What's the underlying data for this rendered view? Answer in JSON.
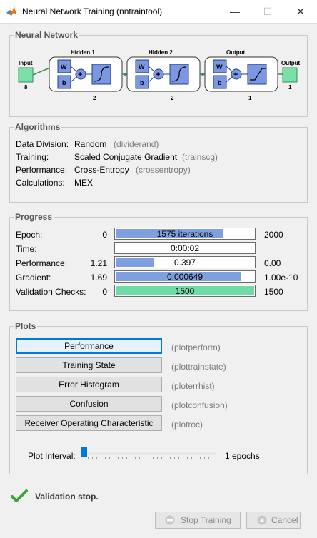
{
  "window": {
    "title": "Neural Network Training (nntraintool)",
    "controls": {
      "minimize": "—",
      "maximize": "☐",
      "close": "✕"
    }
  },
  "network": {
    "panel_title": "Neural Network",
    "input_label": "Input",
    "input_size": "8",
    "layers": [
      {
        "title": "Hidden 1",
        "size": "2"
      },
      {
        "title": "Hidden 2",
        "size": "2"
      },
      {
        "title": "Output",
        "size": "1"
      }
    ],
    "output_label": "Output",
    "output_size": "1",
    "w_label": "W",
    "b_label": "b",
    "plus_label": "+"
  },
  "algorithms": {
    "panel_title": "Algorithms",
    "rows": [
      {
        "label": "Data Division:",
        "value": "Random",
        "fn": "(dividerand)"
      },
      {
        "label": "Training:",
        "value": "Scaled Conjugate Gradient",
        "fn": "(trainscg)"
      },
      {
        "label": "Performance:",
        "value": "Cross-Entropy",
        "fn": "(crossentropy)"
      },
      {
        "label": "Calculations:",
        "value": "MEX",
        "fn": ""
      }
    ]
  },
  "progress": {
    "panel_title": "Progress",
    "rows": [
      {
        "label": "Epoch:",
        "start": "0",
        "value": "1575 iterations",
        "end": "2000",
        "fill": 0.775,
        "color": "#7e9fe0"
      },
      {
        "label": "Time:",
        "start": "",
        "value": "0:00:02",
        "end": "",
        "fill": 0,
        "color": "#7e9fe0"
      },
      {
        "label": "Performance:",
        "start": "1.21",
        "value": "0.397",
        "end": "0.00",
        "fill": 0.28,
        "color": "#7e9fe0"
      },
      {
        "label": "Gradient:",
        "start": "1.69",
        "value": "0.000649",
        "end": "1.00e-10",
        "fill": 0.905,
        "color": "#7e9fe0"
      },
      {
        "label": "Validation Checks:",
        "start": "0",
        "value": "1500",
        "end": "1500",
        "fill": 1.0,
        "color": "#6fdca6"
      }
    ]
  },
  "plots": {
    "panel_title": "Plots",
    "buttons": [
      {
        "label": "Performance",
        "fn": "(plotperform)"
      },
      {
        "label": "Training State",
        "fn": "(plottrainstate)"
      },
      {
        "label": "Error Histogram",
        "fn": "(ploterrhist)"
      },
      {
        "label": "Confusion",
        "fn": "(plotconfusion)"
      },
      {
        "label": "Receiver Operating Characteristic",
        "fn": "(plotroc)"
      }
    ],
    "interval_label": "Plot Interval:",
    "interval_value": "1 epochs",
    "slider_fraction": 0.0
  },
  "status": {
    "text": "Validation stop.",
    "icon": "checkmark-icon"
  },
  "footer": {
    "stop_label": "Stop Training",
    "cancel_label": "Cancel"
  },
  "colors": {
    "progress_fill": "#7e9fe0",
    "validation_fill": "#6fdca6",
    "node_fill": "#7be0a8",
    "block_fill": "#7c97e2",
    "check_green": "#3aa63a"
  }
}
